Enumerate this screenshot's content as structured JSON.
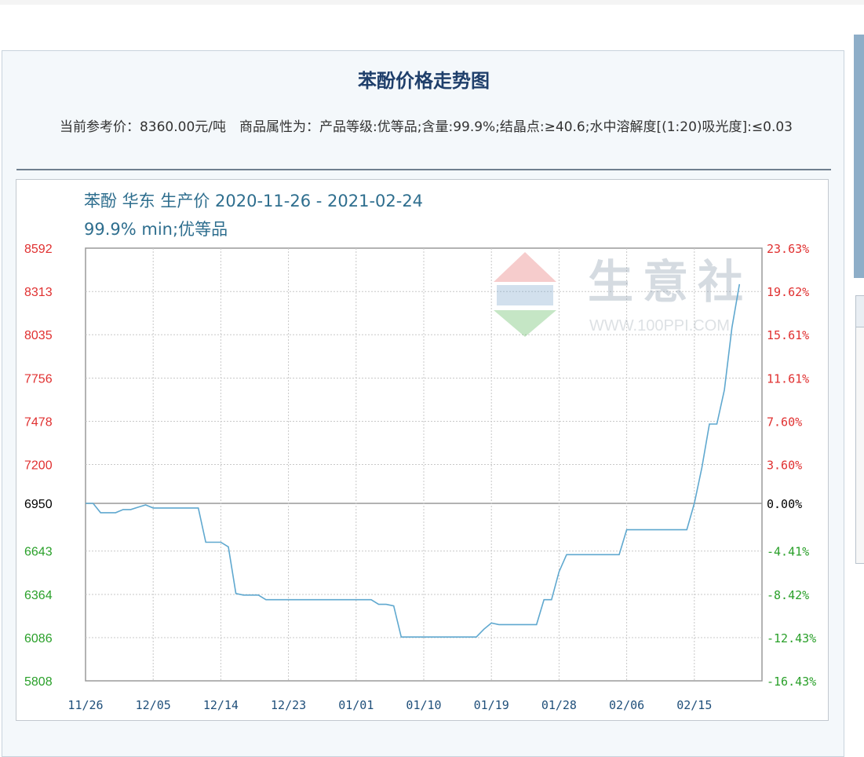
{
  "page": {
    "title": "苯酚价格走势图",
    "info_line": "当前参考价：8360.00元/吨　商品属性为：产品等级:优等品;含量:99.9%;结晶点:≥40.6;水中溶解度[(1:20)吸光度]:≤0.03"
  },
  "chart_data": {
    "type": "line",
    "title": "苯酚 华东 生产价 2020-11-26 - 2021-02-24",
    "subtitle": "99.9% min;优等品",
    "watermark": {
      "text": "生意社",
      "url": "WWW.100PPI.COM"
    },
    "x_tick_labels": [
      "11/26",
      "12/05",
      "12/14",
      "12/23",
      "01/01",
      "01/10",
      "01/19",
      "01/28",
      "02/06",
      "02/15"
    ],
    "x_range": [
      "2020-11-26",
      "2021-02-24"
    ],
    "y_tick_labels": [
      "8592",
      "8313",
      "8035",
      "7756",
      "7478",
      "7200",
      "6950",
      "6643",
      "6364",
      "6086",
      "5808"
    ],
    "y_right_tick_labels": [
      "23.63%",
      "19.62%",
      "15.61%",
      "11.61%",
      "7.60%",
      "3.60%",
      "0.00%",
      "-4.41%",
      "-8.42%",
      "-12.43%",
      "-16.43%"
    ],
    "ylim": [
      5808,
      8592
    ],
    "baseline": 6950,
    "colors": {
      "line": "#5fa8cf",
      "up_label": "#e03030",
      "down_label": "#2aa02a",
      "base_label": "#000000",
      "axis_text": "#1f4f7a",
      "title_text": "#2e6e8e"
    },
    "series": [
      {
        "points": [
          [
            "2020-11-26",
            6950
          ],
          [
            "2020-11-27",
            6950
          ],
          [
            "2020-11-28",
            6890
          ],
          [
            "2020-11-29",
            6890
          ],
          [
            "2020-11-30",
            6890
          ],
          [
            "2020-12-01",
            6910
          ],
          [
            "2020-12-02",
            6910
          ],
          [
            "2020-12-03",
            6925
          ],
          [
            "2020-12-04",
            6940
          ],
          [
            "2020-12-05",
            6920
          ],
          [
            "2020-12-11",
            6920
          ],
          [
            "2020-12-12",
            6700
          ],
          [
            "2020-12-13",
            6700
          ],
          [
            "2020-12-14",
            6700
          ],
          [
            "2020-12-15",
            6670
          ],
          [
            "2020-12-16",
            6370
          ],
          [
            "2020-12-17",
            6360
          ],
          [
            "2020-12-18",
            6360
          ],
          [
            "2020-12-19",
            6360
          ],
          [
            "2020-12-20",
            6330
          ],
          [
            "2021-01-03",
            6330
          ],
          [
            "2021-01-04",
            6300
          ],
          [
            "2021-01-05",
            6300
          ],
          [
            "2021-01-06",
            6290
          ],
          [
            "2021-01-07",
            6090
          ],
          [
            "2021-01-17",
            6090
          ],
          [
            "2021-01-18",
            6140
          ],
          [
            "2021-01-19",
            6180
          ],
          [
            "2021-01-20",
            6170
          ],
          [
            "2021-01-25",
            6170
          ],
          [
            "2021-01-26",
            6330
          ],
          [
            "2021-01-27",
            6330
          ],
          [
            "2021-01-28",
            6510
          ],
          [
            "2021-01-29",
            6620
          ],
          [
            "2021-02-05",
            6620
          ],
          [
            "2021-02-06",
            6780
          ],
          [
            "2021-02-14",
            6780
          ],
          [
            "2021-02-15",
            6950
          ],
          [
            "2021-02-16",
            7180
          ],
          [
            "2021-02-17",
            7460
          ],
          [
            "2021-02-18",
            7460
          ],
          [
            "2021-02-19",
            7680
          ],
          [
            "2021-02-20",
            8080
          ],
          [
            "2021-02-21",
            8360
          ]
        ]
      }
    ]
  }
}
